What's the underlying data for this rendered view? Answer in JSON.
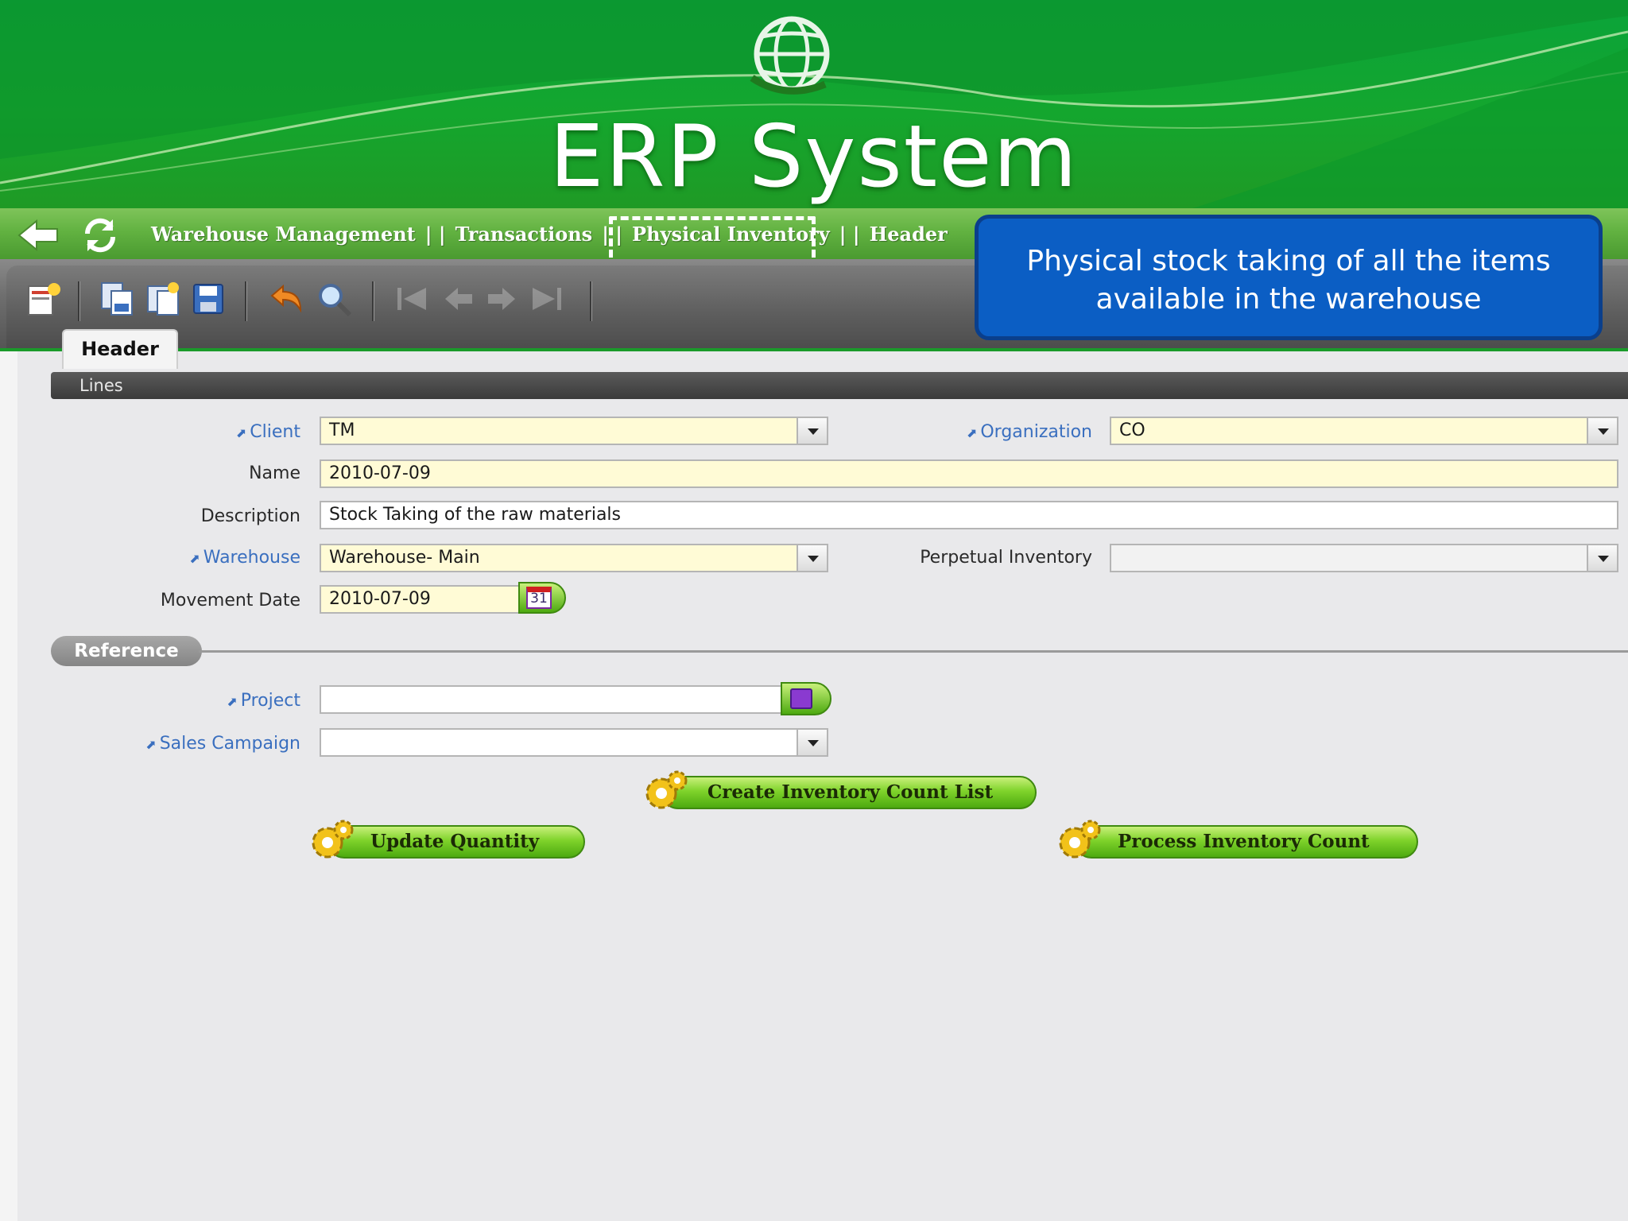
{
  "banner": {
    "title": "ERP System"
  },
  "navbar": {
    "breadcrumb": [
      "Warehouse Management",
      "| |",
      "Transactions",
      "| |",
      "Physical Inventory",
      "| |",
      "Header"
    ]
  },
  "tabs": {
    "active": "Header",
    "lines": "Lines"
  },
  "form": {
    "client": {
      "label": "Client",
      "value": "TM"
    },
    "organization": {
      "label": "Organization",
      "value": "CO"
    },
    "name": {
      "label": "Name",
      "value": "2010-07-09"
    },
    "description": {
      "label": "Description",
      "value": "Stock Taking of the raw materials"
    },
    "warehouse": {
      "label": "Warehouse",
      "value": "Warehouse- Main"
    },
    "perpetual_inventory": {
      "label": "Perpetual Inventory",
      "value": ""
    },
    "movement_date": {
      "label": "Movement Date",
      "value": "2010-07-09",
      "calendar_day": "31"
    }
  },
  "reference": {
    "title": "Reference",
    "project": {
      "label": "Project",
      "value": ""
    },
    "sales_campaign": {
      "label": "Sales Campaign",
      "value": ""
    }
  },
  "actions": {
    "create_count_list": "Create Inventory Count List",
    "update_quantity": "Update Quantity",
    "process_count": "Process Inventory Count"
  },
  "callout": {
    "line1": "Physical stock taking of all the items",
    "line2": "available in the warehouse"
  },
  "icons": {
    "back": "back-arrow-icon",
    "refresh": "refresh-icon",
    "new": "new-record-icon",
    "copy": "copy-record-icon",
    "copy_details": "copy-details-icon",
    "save": "save-icon",
    "undo": "undo-icon",
    "find": "find-icon",
    "first": "first-record-icon",
    "prev": "previous-record-icon",
    "next": "next-record-icon",
    "last": "last-record-icon",
    "gear": "gear-icon",
    "calendar": "calendar-icon",
    "search": "search-icon"
  },
  "colors": {
    "accent_green": "#4daa10",
    "callout_blue": "#0b5ec4",
    "required_field": "#fffbd6",
    "link": "#3a6fbf"
  }
}
